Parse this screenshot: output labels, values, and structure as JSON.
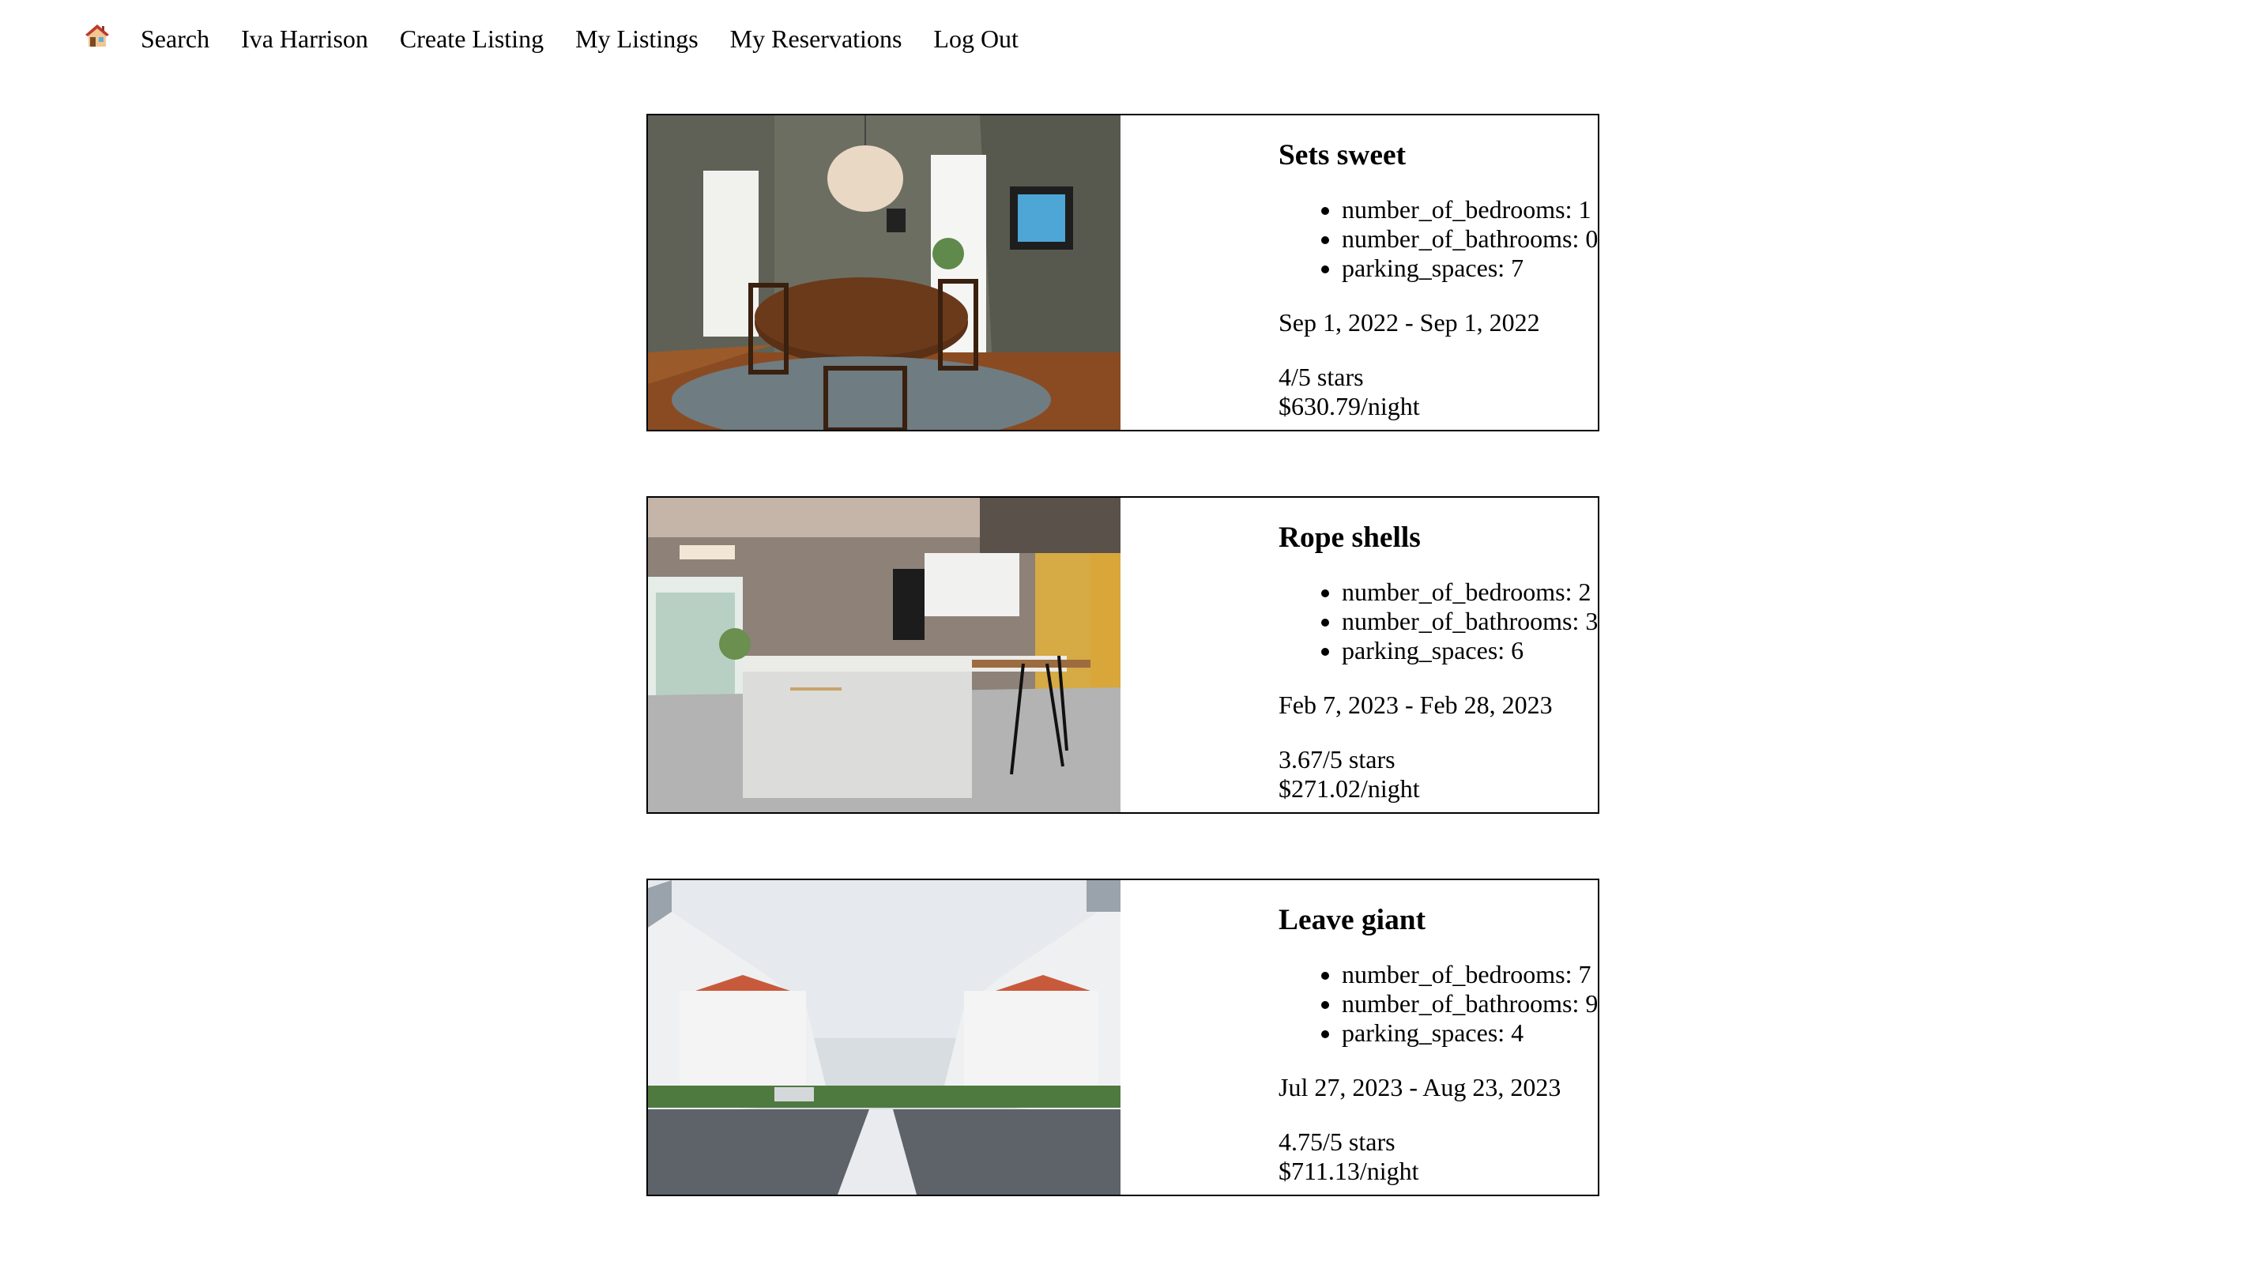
{
  "nav": {
    "home_icon": "house-icon",
    "items": [
      {
        "label": "Search"
      },
      {
        "label": "Iva Harrison"
      },
      {
        "label": "Create Listing"
      },
      {
        "label": "My Listings"
      },
      {
        "label": "My Reservations"
      },
      {
        "label": "Log Out"
      }
    ]
  },
  "listings": [
    {
      "title": "Sets sweet",
      "features": [
        "number_of_bedrooms: 1",
        "number_of_bathrooms: 0",
        "parking_spaces: 7"
      ],
      "dates": "Sep 1, 2022 - Sep 1, 2022",
      "rating": "4/5 stars",
      "price": "$630.79/night",
      "image": "dining-room-photo"
    },
    {
      "title": "Rope shells",
      "features": [
        "number_of_bedrooms: 2",
        "number_of_bathrooms: 3",
        "parking_spaces: 6"
      ],
      "dates": "Feb 7, 2023 - Feb 28, 2023",
      "rating": "3.67/5 stars",
      "price": "$271.02/night",
      "image": "kitchen-photo"
    },
    {
      "title": "Leave giant",
      "features": [
        "number_of_bedrooms: 7",
        "number_of_bathrooms: 9",
        "parking_spaces: 4"
      ],
      "dates": "Jul 27, 2023 - Aug 23, 2023",
      "rating": "4.75/5 stars",
      "price": "$711.13/night",
      "image": "street-houses-photo"
    }
  ]
}
